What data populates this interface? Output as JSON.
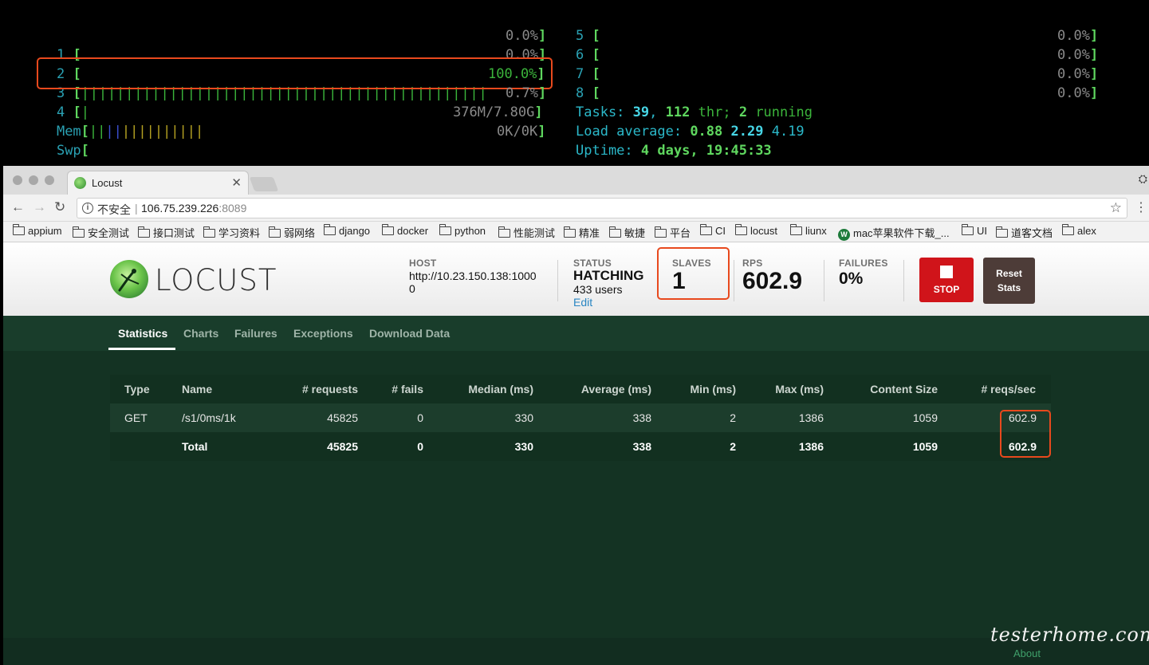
{
  "terminal": {
    "cpu_left": [
      {
        "num": "1",
        "bars": "",
        "pct": "0.0%"
      },
      {
        "num": "2",
        "bars": "",
        "pct": "0.0%"
      },
      {
        "num": "3",
        "bars": "||||||||||||||||||||||||||||||||||||||||||||||",
        "pct": "100.0%"
      },
      {
        "num": "4",
        "bars": "|",
        "pct": "0.7%"
      }
    ],
    "cpu_right": [
      {
        "num": "5",
        "pct": "0.0%"
      },
      {
        "num": "6",
        "pct": "0.0%"
      },
      {
        "num": "7",
        "pct": "0.0%"
      },
      {
        "num": "8",
        "pct": "0.0%"
      }
    ],
    "mem_label": "Mem",
    "mem_value": "376M/7.80G",
    "swp_label": "Swp",
    "swp_value": "0K/0K",
    "tasks_label": "Tasks:",
    "tasks_count": "39",
    "threads": "112",
    "thr_label": "thr;",
    "running_count": "2",
    "running_label": "running",
    "load_label": "Load average:",
    "load_1": "0.88",
    "load_5": "2.29",
    "load_15": "4.19",
    "uptime_label": "Uptime:",
    "uptime_value": "4 days, 19:45:33"
  },
  "browser": {
    "tab_title": "Locust",
    "insecure_label": "不安全",
    "url_host": "106.75.239.226",
    "url_port": ":8089",
    "bookmarks": [
      "appium",
      "安全测试",
      "接口测试",
      "学习资料",
      "弱网络",
      "django",
      "docker",
      "python",
      "性能测试",
      "精准",
      "敏捷",
      "平台",
      "CI",
      "locust",
      "liunx",
      "mac苹果软件下载_...",
      "UI",
      "道客文档",
      "alex"
    ]
  },
  "locust": {
    "logo_text": "LOCUST",
    "host_label": "HOST",
    "host_value": "http://10.23.150.138:10000",
    "status_label": "STATUS",
    "status_value": "HATCHING",
    "users_value": "433 users",
    "edit_label": "Edit",
    "slaves_label": "SLAVES",
    "slaves_value": "1",
    "rps_label": "RPS",
    "rps_value": "602.9",
    "failures_label": "FAILURES",
    "failures_value": "0%",
    "stop_label": "STOP",
    "reset_label_1": "Reset",
    "reset_label_2": "Stats",
    "tabs": [
      "Statistics",
      "Charts",
      "Failures",
      "Exceptions",
      "Download Data"
    ],
    "table": {
      "headers": [
        "Type",
        "Name",
        "# requests",
        "# fails",
        "Median (ms)",
        "Average (ms)",
        "Min (ms)",
        "Max (ms)",
        "Content Size",
        "# reqs/sec"
      ],
      "rows": [
        [
          "GET",
          "/s1/0ms/1k",
          "45825",
          "0",
          "330",
          "338",
          "2",
          "1386",
          "1059",
          "602.9"
        ],
        [
          "",
          "Total",
          "45825",
          "0",
          "330",
          "338",
          "2",
          "1386",
          "1059",
          "602.9"
        ]
      ]
    },
    "about_label": "About"
  },
  "watermark": "testerhome.com",
  "colors": {
    "highlight_box": "#e8491d",
    "page_bg": "#143323",
    "stop_button": "#d0141a",
    "reset_button": "#4d3c38"
  }
}
